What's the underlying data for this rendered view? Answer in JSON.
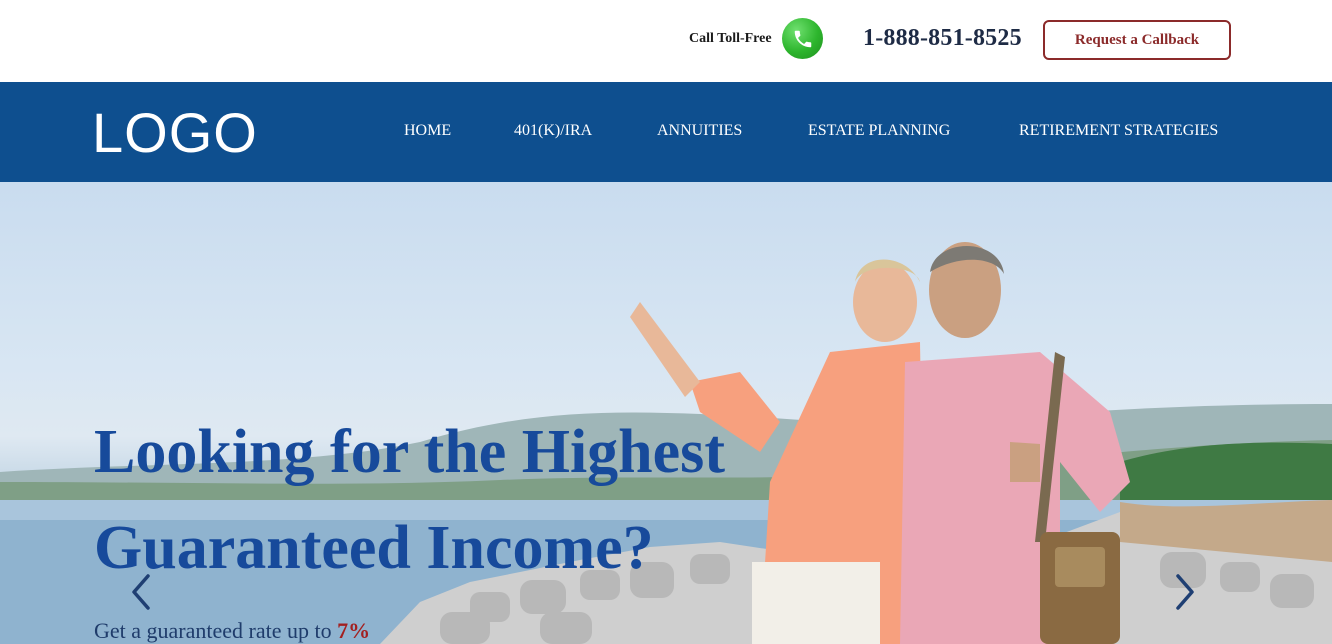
{
  "header": {
    "call_label": "Call Toll-Free",
    "phone_number": "1-888-851-8525",
    "callback_label": "Request a Callback",
    "phone_icon": "phone-icon"
  },
  "nav": {
    "logo": "LOGO",
    "items": [
      {
        "label": "HOME"
      },
      {
        "label": "401(K)/IRA"
      },
      {
        "label": "ANNUITIES"
      },
      {
        "label": "ESTATE PLANNING"
      },
      {
        "label": "RETIREMENT STRATEGIES"
      }
    ]
  },
  "hero": {
    "headline_line1": "Looking for the Highest",
    "headline_line2": "Guaranteed Income?",
    "sub_text": "Get a guaranteed rate up to ",
    "sub_rate": "7%",
    "prev_icon": "chevron-left-icon",
    "next_icon": "chevron-right-icon"
  },
  "colors": {
    "nav_bg": "#0e4f8f",
    "headline": "#174a9b",
    "accent_red": "#8b2a2a",
    "phone_green": "#2db52d"
  }
}
